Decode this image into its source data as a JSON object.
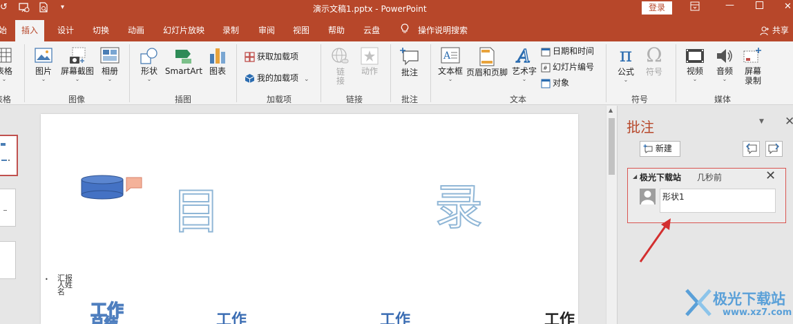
{
  "titlebar": {
    "title": "演示文稿1.pptx  -  PowerPoint",
    "login": "登录",
    "quick_access": [
      "undo-icon",
      "present-from-start-icon",
      "print-preview-icon",
      "customize-qat-icon"
    ],
    "window_controls": [
      "ribbon-display-icon",
      "minimize-icon",
      "maximize-icon",
      "close-icon"
    ]
  },
  "tabs": [
    "始",
    "插入",
    "设计",
    "切换",
    "动画",
    "幻灯片放映",
    "录制",
    "审阅",
    "视图",
    "帮助",
    "云盘"
  ],
  "active_tab": "插入",
  "tell_me": "操作说明搜索",
  "share": "共享",
  "ribbon": {
    "table": {
      "label": "表格",
      "group": "表格"
    },
    "images": {
      "picture": "图片",
      "screenshot": "屏幕截图",
      "album": "相册",
      "group": "图像"
    },
    "illustrations": {
      "shapes": "形状",
      "smartart": "SmartArt",
      "chart": "图表",
      "group": "插图"
    },
    "addins": {
      "get": "获取加载项",
      "mine": "我的加载项",
      "group": "加载项"
    },
    "links": {
      "link": "链\n接",
      "action": "动作",
      "group": "链接"
    },
    "comments": {
      "comment": "批注",
      "group": "批注"
    },
    "text": {
      "textbox": "文本框",
      "header_footer": "页眉和页脚",
      "wordart": "艺术字",
      "datetime": "日期和时间",
      "slide_number": "幻灯片编号",
      "object": "对象",
      "group": "文本"
    },
    "symbols": {
      "equation": "公式",
      "symbol": "符号",
      "group": "符号"
    },
    "media": {
      "video": "视频",
      "audio": "音频",
      "screen_record_1": "屏幕",
      "screen_record_2": "录制",
      "group": "媒体"
    }
  },
  "slide": {
    "char_left": "目",
    "char_right": "录",
    "bullet_text": "汇报人姓名",
    "work_items": [
      "工作",
      "工作",
      "工作",
      "工作"
    ],
    "sub_item": "总结"
  },
  "comments_pane": {
    "title": "批注",
    "new_button": "新建",
    "comment": {
      "author": "极光下载站",
      "time": "几秒前",
      "text": "形状1"
    }
  },
  "watermark": {
    "name": "极光下载站",
    "url": "www.xz7.com"
  },
  "colors": {
    "accent": "#b7472a",
    "comment_border": "#d9534f",
    "arrow": "#d32f2f"
  }
}
